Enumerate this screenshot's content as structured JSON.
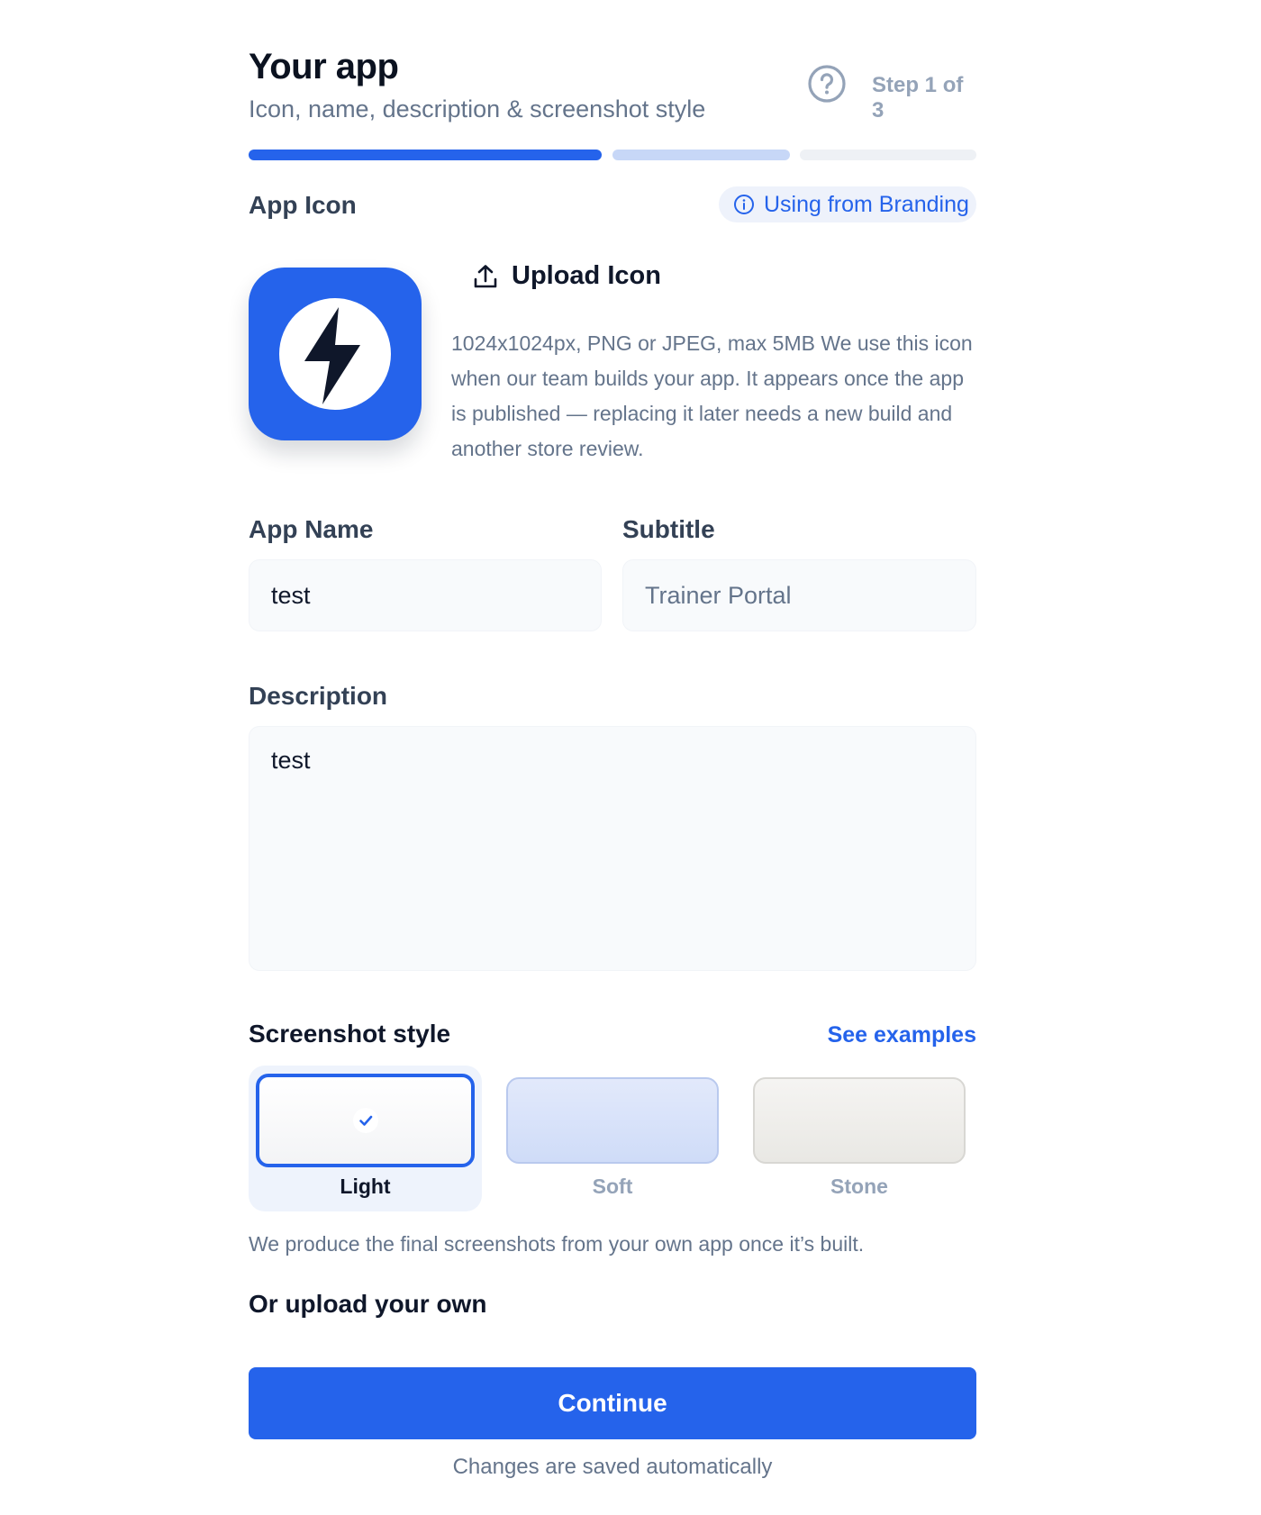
{
  "header": {
    "title": "Your app",
    "subtitle": "Icon, name, description & screenshot style",
    "step_text": "Step 1 of 3",
    "help_icon": "question-circle-icon",
    "progress": {
      "current_step": 1,
      "total_steps": 3
    }
  },
  "app_icon": {
    "label": "App Icon",
    "branding_badge": "Using from Branding",
    "icon_name": "lightning-bolt-icon",
    "icon_color": "#2563eb",
    "upload_label": "Upload Icon",
    "description": "1024x1024px, PNG or JPEG, max 5MB We use this icon when our team builds your app. It appears once the app is published — replacing it later needs a new build and another store review."
  },
  "app_name": {
    "label": "App Name",
    "value": "test"
  },
  "subtitle_field": {
    "label": "Subtitle",
    "placeholder": "Trainer Portal"
  },
  "description_field": {
    "label": "Description",
    "value": "test"
  },
  "screenshot_style": {
    "label": "Screenshot style",
    "see_examples": "See examples",
    "options": [
      {
        "label": "Light",
        "selected": true
      },
      {
        "label": "Soft",
        "selected": false
      },
      {
        "label": "Stone",
        "selected": false
      }
    ],
    "note": "We produce the final screenshots from your own app once it’s built.",
    "upload_own": "Or upload your own"
  },
  "footer": {
    "continue_label": "Continue",
    "saved_note": "Changes are saved automatically"
  },
  "colors": {
    "accent": "#2563eb",
    "muted_text": "#64748b"
  }
}
